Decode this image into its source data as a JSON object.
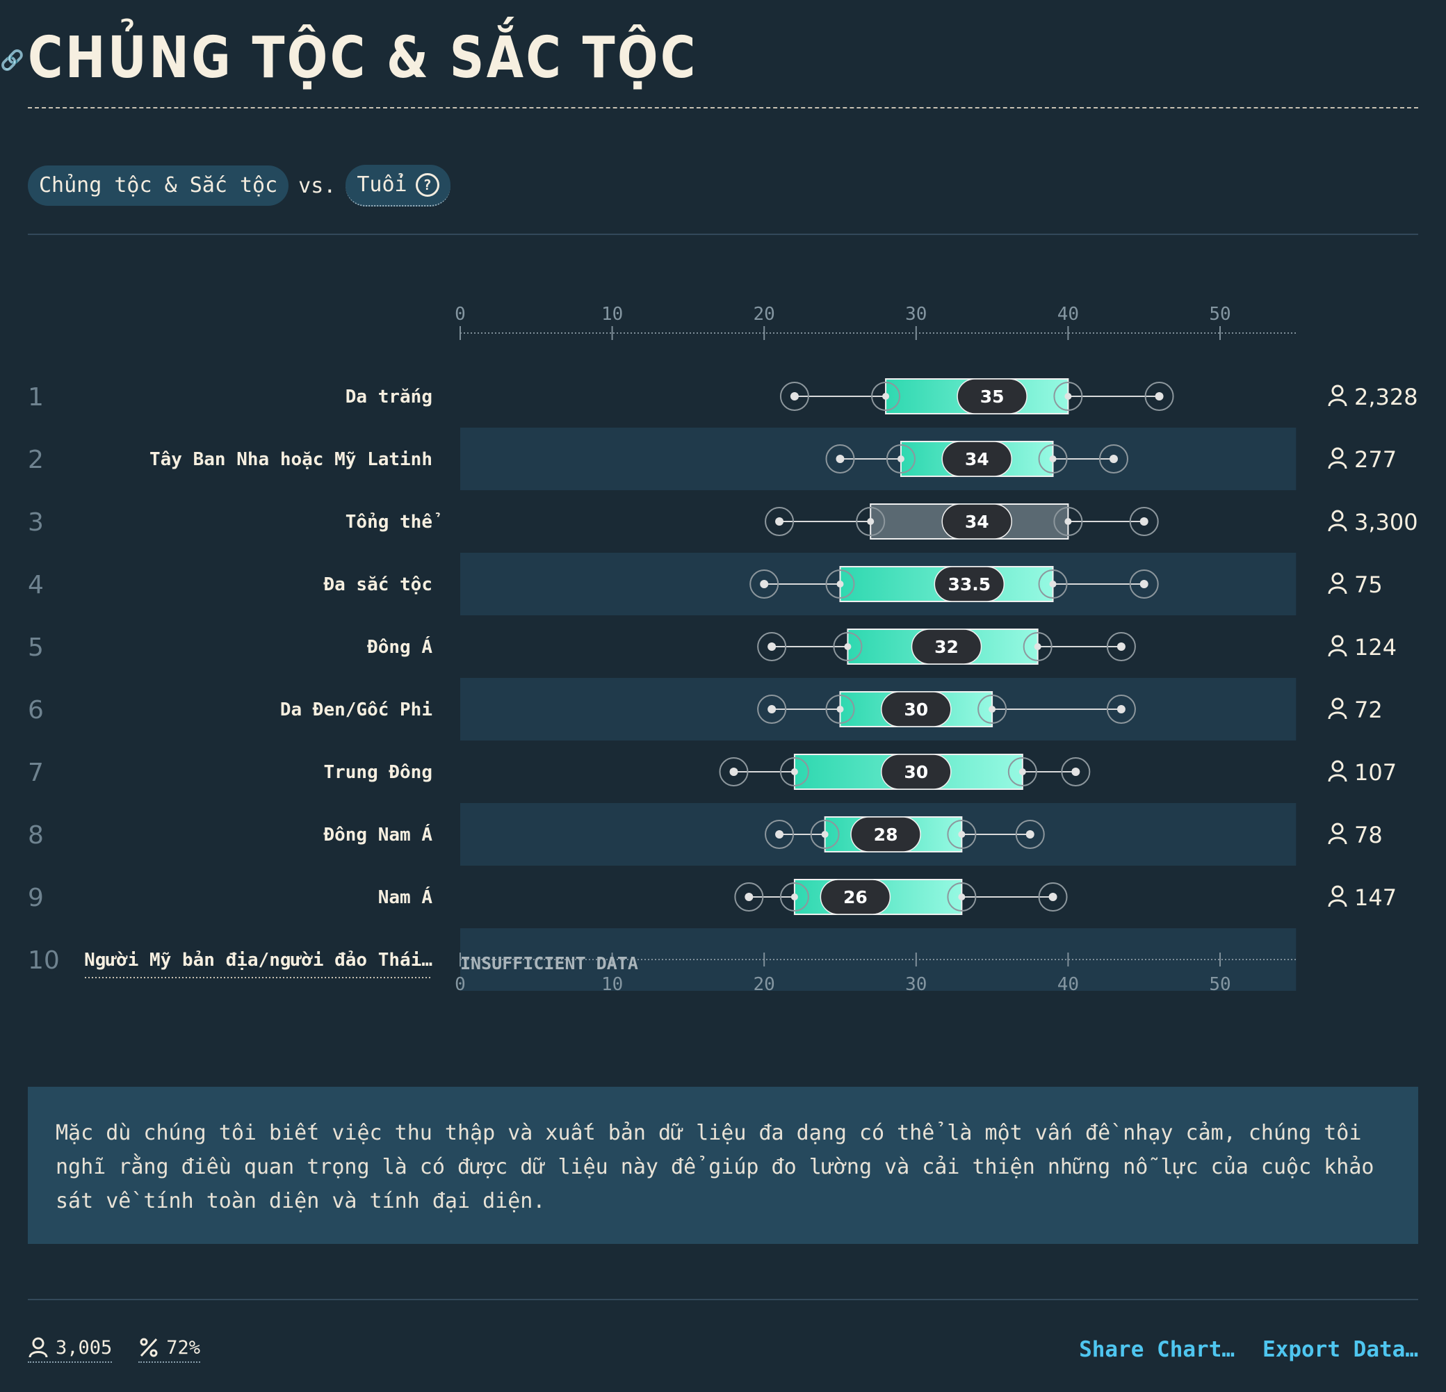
{
  "header": {
    "title": "CHỦNG TỘC & SẮC TỘC"
  },
  "filters": {
    "category": "Chủng tộc & Sắc tộc",
    "vs": "vs.",
    "metric": "Tuổi"
  },
  "chart_data": {
    "type": "boxplot",
    "xlim": [
      0,
      55
    ],
    "ticks": [
      0,
      10,
      20,
      30,
      40,
      50
    ],
    "rows": [
      {
        "rank": "1",
        "label": "Da trắng",
        "min": 22,
        "q1": 28,
        "median": 35,
        "q3": 40,
        "max": 46,
        "count": "2,328",
        "overall": false
      },
      {
        "rank": "2",
        "label": "Tây Ban Nha hoặc Mỹ Latinh",
        "min": 25,
        "q1": 29,
        "median": 34,
        "q3": 39,
        "max": 43,
        "count": "277",
        "overall": false
      },
      {
        "rank": "3",
        "label": "Tổng thể",
        "min": 21,
        "q1": 27,
        "median": 34,
        "q3": 40,
        "max": 45,
        "count": "3,300",
        "overall": true
      },
      {
        "rank": "4",
        "label": "Đa sắc tộc",
        "min": 20,
        "q1": 25,
        "median": 33.5,
        "q3": 39,
        "max": 45,
        "count": "75",
        "overall": false
      },
      {
        "rank": "5",
        "label": "Đông Á",
        "min": 20.5,
        "q1": 25.5,
        "median": 32,
        "q3": 38,
        "max": 43.5,
        "count": "124",
        "overall": false
      },
      {
        "rank": "6",
        "label": "Da Đen/Gốc Phi",
        "min": 20.5,
        "q1": 25,
        "median": 30,
        "q3": 35,
        "max": 43.5,
        "count": "72",
        "overall": false
      },
      {
        "rank": "7",
        "label": "Trung Đông",
        "min": 18,
        "q1": 22,
        "median": 30,
        "q3": 37,
        "max": 40.5,
        "count": "107",
        "overall": false
      },
      {
        "rank": "8",
        "label": "Đông Nam Á",
        "min": 21,
        "q1": 24,
        "median": 28,
        "q3": 33,
        "max": 37.5,
        "count": "78",
        "overall": false
      },
      {
        "rank": "9",
        "label": "Nam Á",
        "min": 19,
        "q1": 22,
        "median": 26,
        "q3": 33,
        "max": 39,
        "count": "147",
        "overall": false
      },
      {
        "rank": "10",
        "label": "Người Mỹ bản địa/người đảo Thái…",
        "insufficient": true,
        "insufficient_label": "INSUFFICIENT DATA"
      }
    ]
  },
  "note": {
    "text": "Mặc dù chúng tôi biết việc thu thập và xuất bản dữ liệu đa dạng có thể là một vấn đề nhạy cảm, chúng tôi nghĩ rằng điều quan trọng là có được dữ liệu này để giúp đo lường và cải thiện những nỗ lực của cuộc khảo sát về tính toàn diện và tính đại diện."
  },
  "footer": {
    "respondents": "3,005",
    "percent": "72%",
    "share_label": "Share Chart…",
    "export_label": "Export Data…"
  },
  "colors": {
    "background": "#1a2a35",
    "band": "#203a4b",
    "box_start": "#2fd8b0",
    "box_end": "#96f9e2",
    "overall_box": "#5a6972",
    "median_pill": "#2b2e33",
    "link": "#4fc6f0"
  }
}
